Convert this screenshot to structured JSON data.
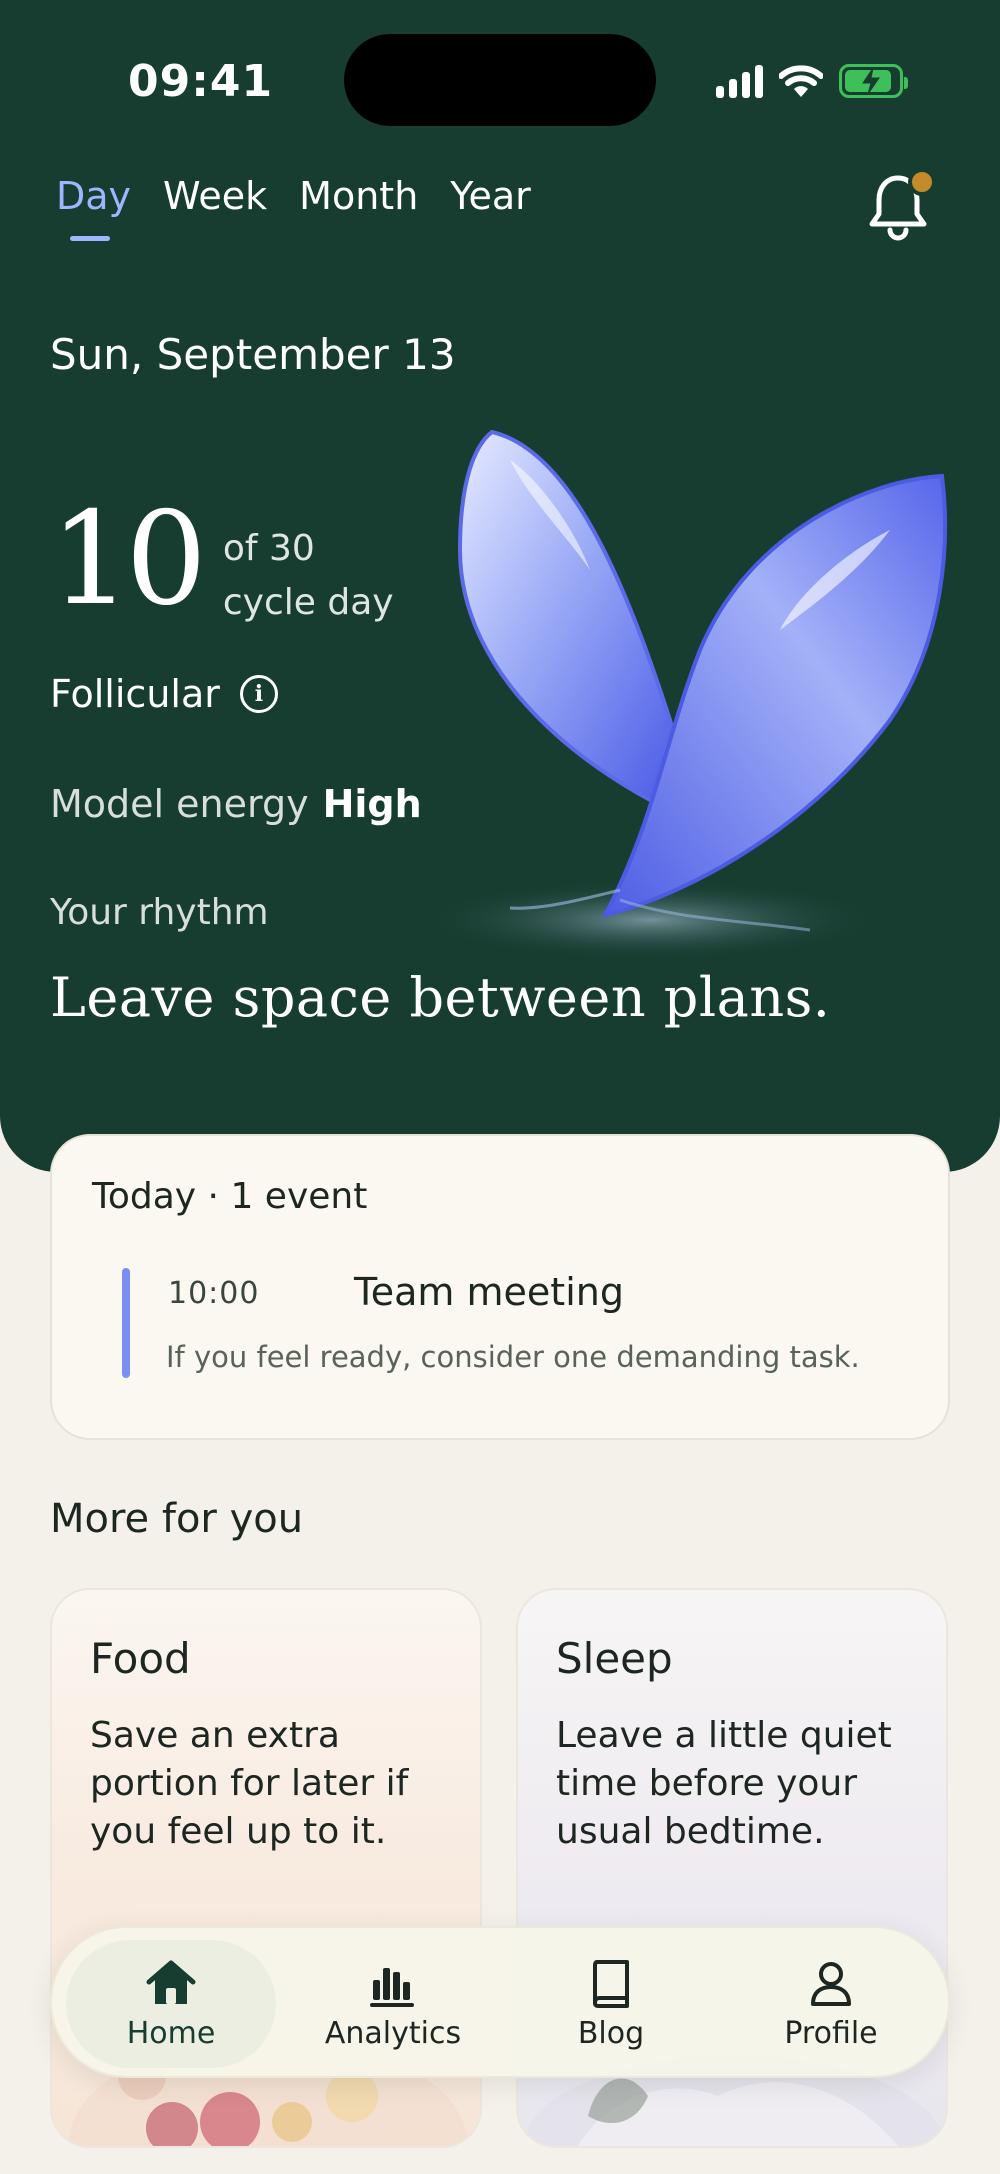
{
  "status_bar": {
    "time": "09:41"
  },
  "tabs": [
    {
      "label": "Day",
      "active": true
    },
    {
      "label": "Week",
      "active": false
    },
    {
      "label": "Month",
      "active": false
    },
    {
      "label": "Year",
      "active": false
    }
  ],
  "notifications": {
    "icon": "bell-icon",
    "has_unread": true
  },
  "date": "Sun, September 13",
  "cycle": {
    "day": "10",
    "total": "of 30",
    "unit": "cycle day"
  },
  "phase": {
    "label": "Follicular",
    "icon": "info-icon"
  },
  "energy": {
    "label": "Model energy",
    "value": "High"
  },
  "rhythm": {
    "label": "Your rhythm",
    "text": "Leave space between plans."
  },
  "today": {
    "title": "Today · 1 event",
    "events": [
      {
        "time": "10:00",
        "name": "Team meeting",
        "note": "If you feel ready, consider one demanding task."
      }
    ]
  },
  "more": {
    "title": "More for you",
    "cards": [
      {
        "title": "Food",
        "text": "Save an extra portion for later if you feel up to it."
      },
      {
        "title": "Sleep",
        "text": "Leave a little quiet time before your usual bedtime."
      }
    ]
  },
  "nav": [
    {
      "label": "Home",
      "icon": "home-icon",
      "active": true
    },
    {
      "label": "Analytics",
      "icon": "analytics-icon",
      "active": false
    },
    {
      "label": "Blog",
      "icon": "book-icon",
      "active": false
    },
    {
      "label": "Profile",
      "icon": "profile-icon",
      "active": false
    }
  ],
  "colors": {
    "hero_bg": "#173d31",
    "accent": "#9fb5ff",
    "event_bar": "#7b8ff0",
    "notification_dot": "#c58a2a",
    "battery": "#3fbf5a"
  }
}
